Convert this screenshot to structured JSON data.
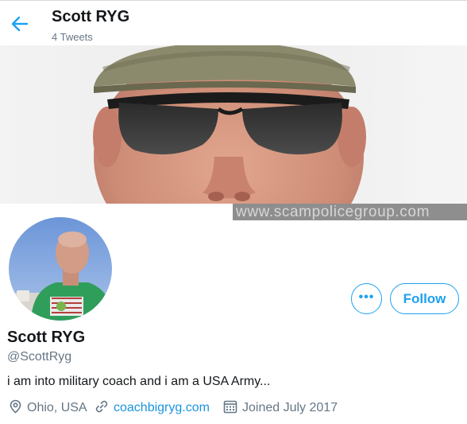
{
  "header": {
    "name": "Scott RYG",
    "tweet_count": "4 Tweets"
  },
  "banner": {
    "watermark": "www.scampolicegroup.com"
  },
  "actions": {
    "more_label": "•••",
    "follow_label": "Follow"
  },
  "profile": {
    "name": "Scott RYG",
    "handle": "@ScottRyg",
    "bio": "i am into military coach and i am a USA Army...",
    "location": "Ohio, USA",
    "website": "coachbigryg.com",
    "joined": "Joined July 2017"
  },
  "colors": {
    "accent": "#1da1f2",
    "link": "#1b95e0",
    "secondary_text": "#657786"
  },
  "icons": {
    "back": "arrow-left-icon",
    "location": "location-pin-icon",
    "website": "link-icon",
    "joined": "calendar-icon"
  }
}
